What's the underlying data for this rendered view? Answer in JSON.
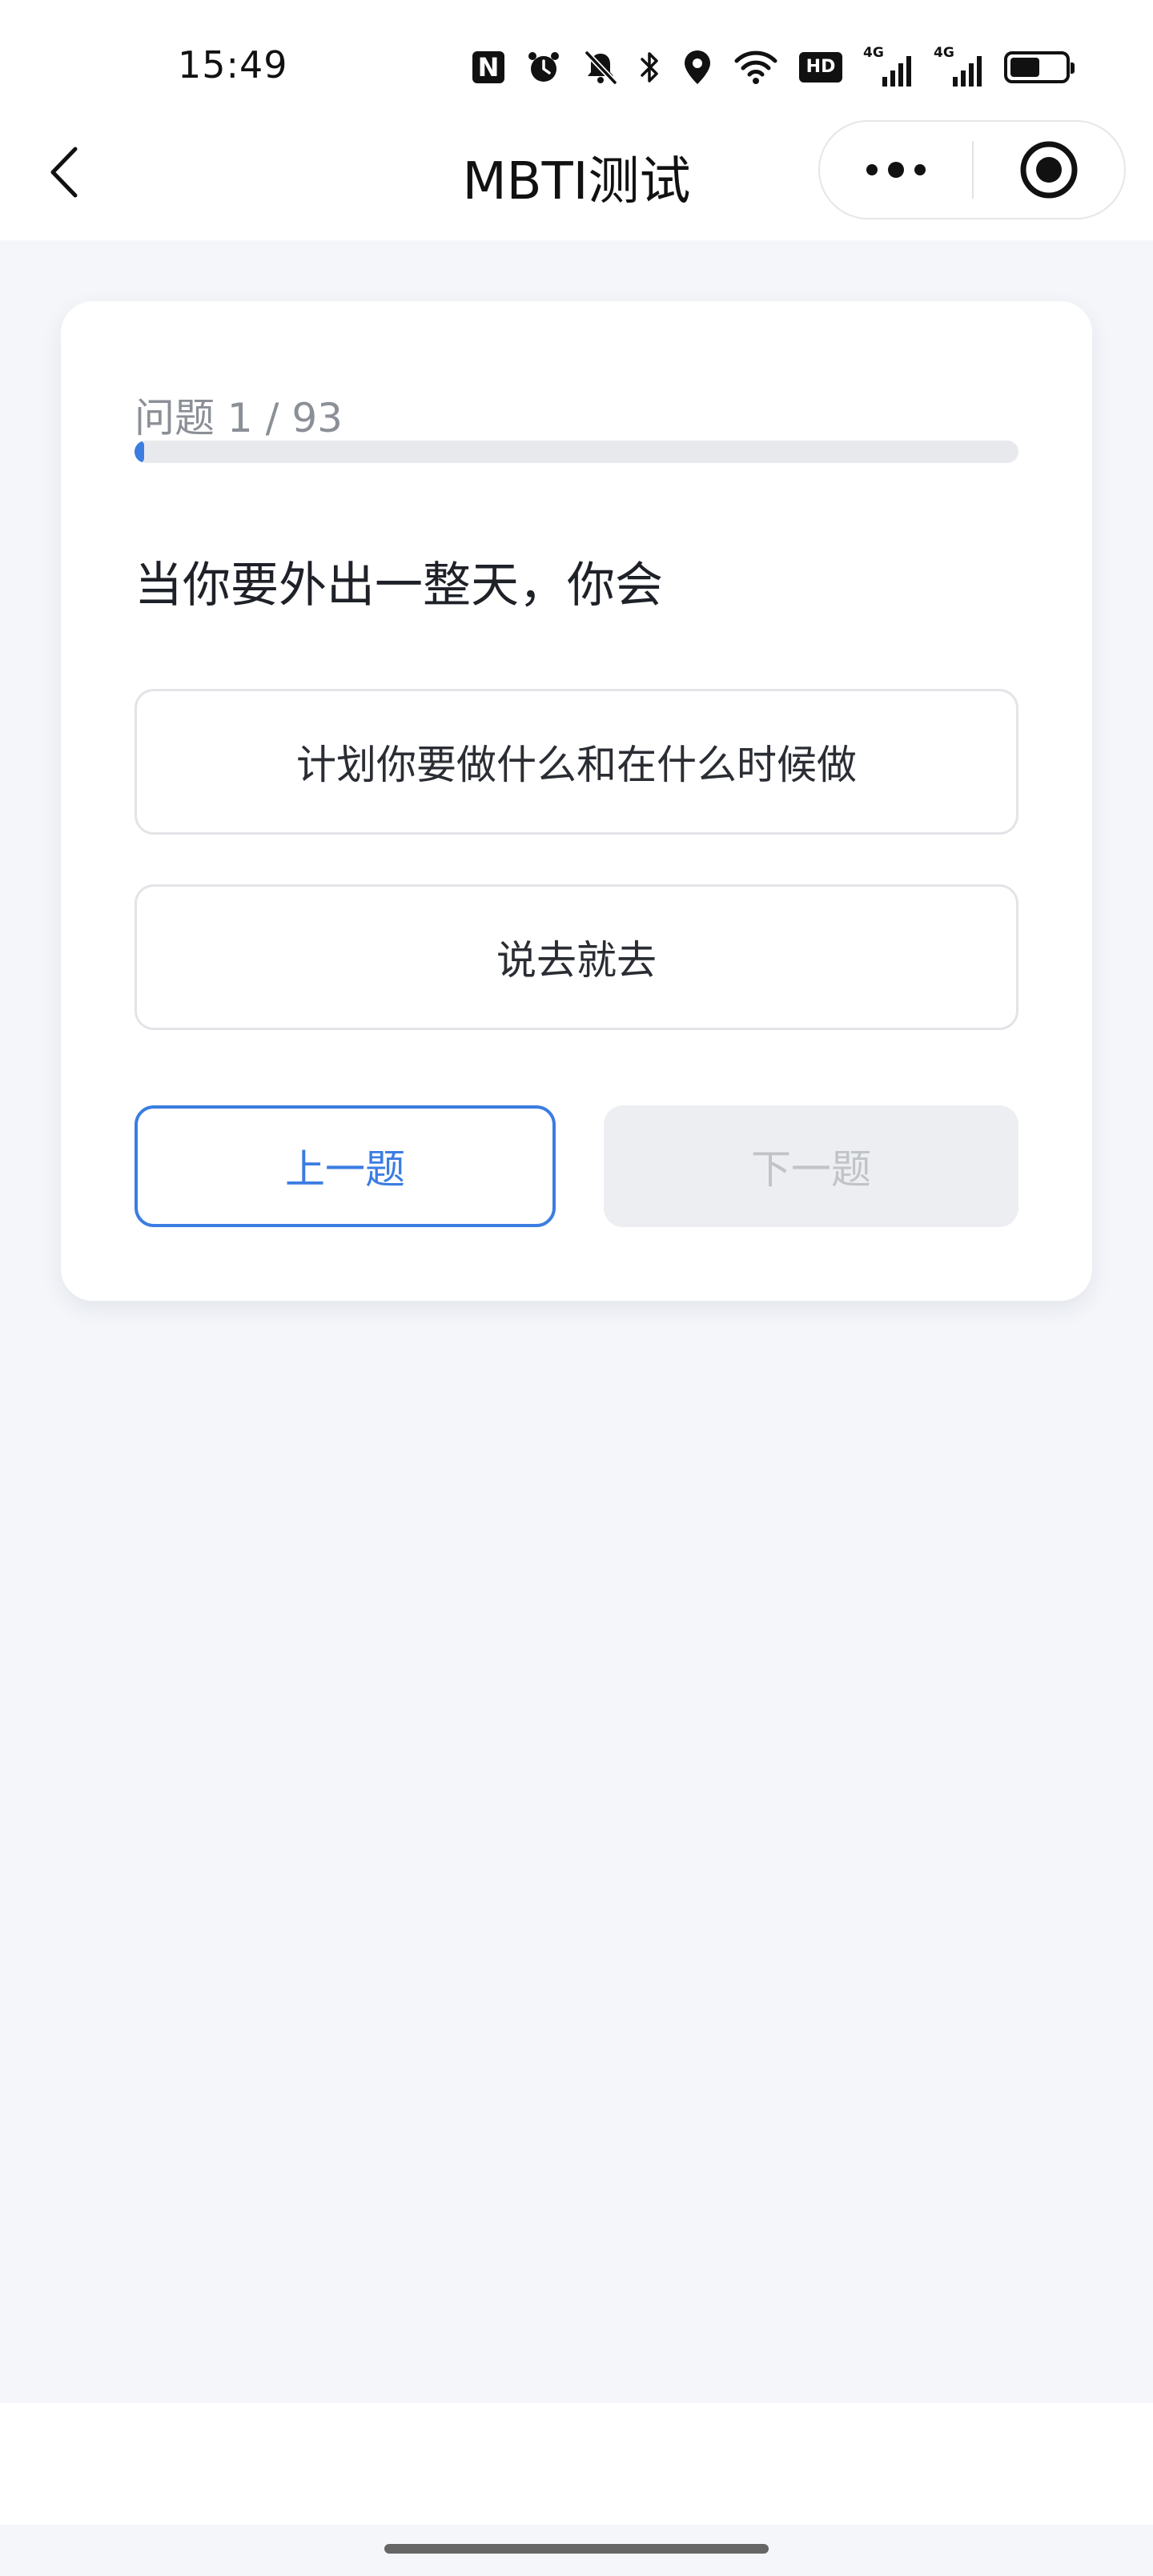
{
  "status_bar": {
    "time": "15:49",
    "icons": [
      "nfc-icon",
      "alarm-icon",
      "bell-muted-icon",
      "bluetooth-icon",
      "location-icon",
      "wifi-icon",
      "hd-icon",
      "signal-4g-icon",
      "signal-4g-icon",
      "battery-icon"
    ],
    "nfc_glyph": "N",
    "hd_label": "HD",
    "network_labels": [
      "4G",
      "4G"
    ],
    "battery_level": 0.55
  },
  "nav": {
    "title": "MBTI测试",
    "back_icon": "chevron-left-icon",
    "more_icon": "more-dots-icon",
    "close_icon": "target-circle-icon"
  },
  "quiz": {
    "progress_label": "问题 1 / 93",
    "current": 1,
    "total": 93,
    "progress_fraction": 0.0108,
    "question": "当你要外出一整天，你会",
    "options": [
      {
        "label": "计划你要做什么和在什么时候做"
      },
      {
        "label": "说去就去"
      }
    ],
    "prev_label": "上一题",
    "next_label": "下一题"
  },
  "colors": {
    "accent": "#3b7de1",
    "background": "#f4f6fa",
    "card": "#ffffff",
    "disabled_bg": "#edeef1",
    "disabled_text": "#c0c3c8"
  }
}
